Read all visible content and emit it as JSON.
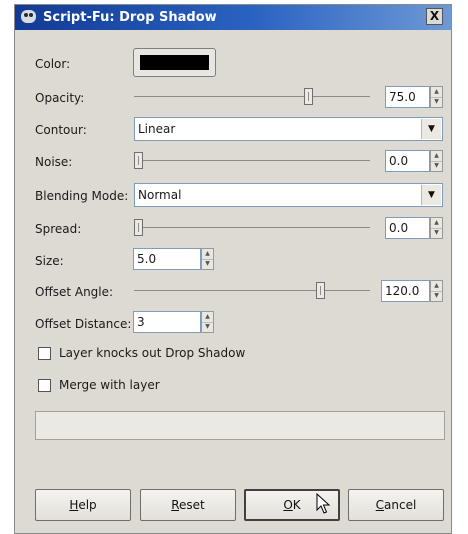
{
  "window": {
    "title": "Script-Fu: Drop Shadow",
    "close_label": "X"
  },
  "color": {
    "label": "Color:",
    "value": "#000000"
  },
  "opacity": {
    "label": "Opacity:",
    "value": "75.0",
    "level_percent": 75
  },
  "contour": {
    "label": "Contour:",
    "value": "Linear"
  },
  "noise": {
    "label": "Noise:",
    "value": "0.0",
    "level_percent": 0
  },
  "blending_mode": {
    "label": "Blending Mode:",
    "value": "Normal"
  },
  "spread": {
    "label": "Spread:",
    "value": "0.0",
    "level_percent": 0
  },
  "size": {
    "label": "Size:",
    "value": "5.0"
  },
  "offset_angle": {
    "label": "Offset Angle:",
    "value": "120.0",
    "level_fraction": 0.8
  },
  "offset_distance": {
    "label": "Offset Distance:",
    "value": "3"
  },
  "checkboxes": {
    "layer_knocks_out": {
      "label": "Layer knocks out Drop Shadow",
      "checked": false
    },
    "merge_with_layer": {
      "label": "Merge with layer",
      "checked": false
    }
  },
  "progress": {
    "value_percent": 0
  },
  "buttons": {
    "help": {
      "mnemonic": "H",
      "rest": "elp"
    },
    "reset": {
      "mnemonic": "R",
      "rest": "eset"
    },
    "ok": {
      "mnemonic": "O",
      "rest": "K"
    },
    "cancel": {
      "mnemonic": "C",
      "rest": "ancel"
    }
  },
  "icons": {
    "app": "gimp-icon",
    "combo_arrow": "chevron-down-icon",
    "spin_up": "spin-up-icon",
    "spin_down": "spin-down-icon",
    "cursor": "mouse-pointer-icon"
  }
}
